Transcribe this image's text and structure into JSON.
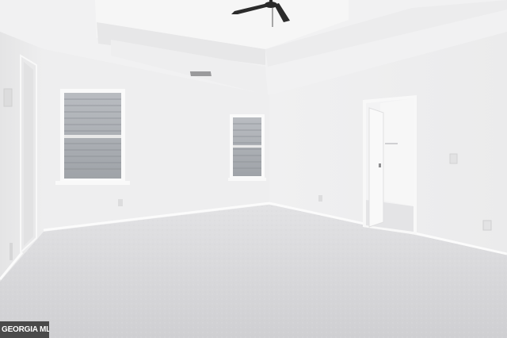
{
  "image": {
    "kind": "photo",
    "scene": "empty-bedroom",
    "colors": {
      "wall": "#efefef",
      "wall_shadow": "#e6e6e7",
      "ceiling": "#f3f3f3",
      "carpet": "#d9d9db",
      "trim": "#fafafa",
      "fan": "#2b2b2b"
    }
  },
  "watermark": {
    "text": "GEORGIA MLS"
  }
}
